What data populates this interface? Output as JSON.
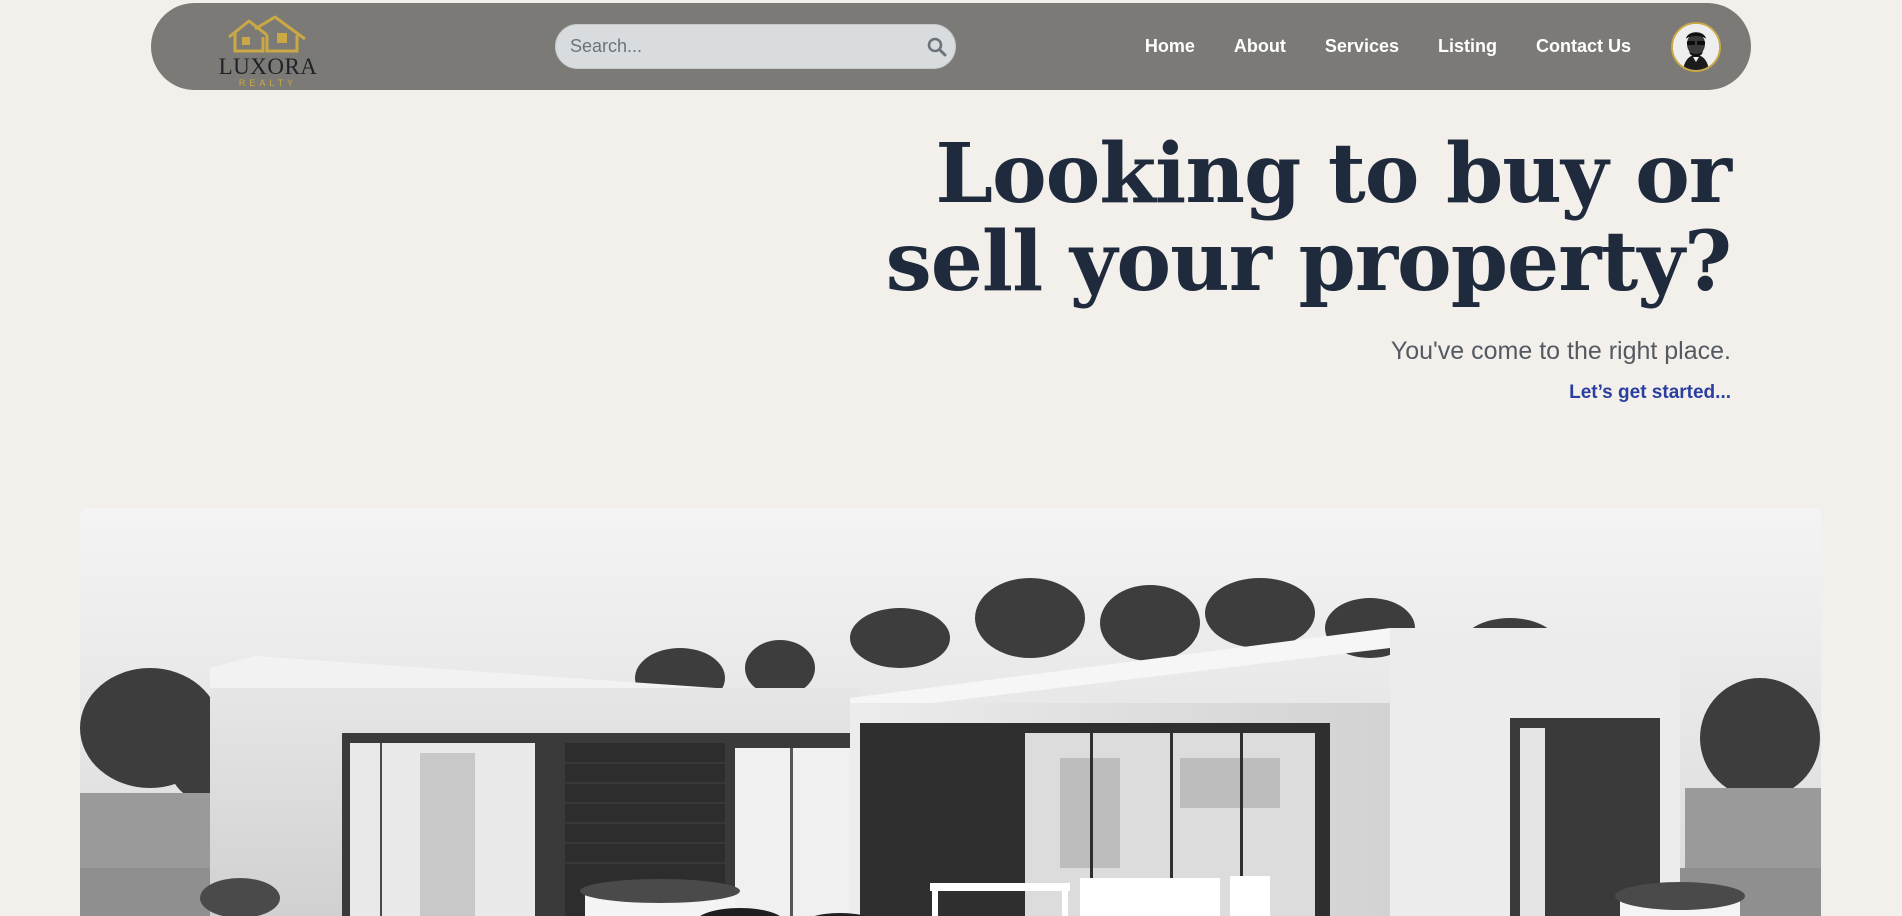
{
  "brand": {
    "name": "LUXORA",
    "tagline": "REALTY",
    "logo_icon": "houses-icon",
    "accent_color": "#c9a845"
  },
  "search": {
    "placeholder": "Search...",
    "icon": "search-icon"
  },
  "nav": {
    "items": [
      {
        "label": "Home"
      },
      {
        "label": "About"
      },
      {
        "label": "Services"
      },
      {
        "label": "Listing"
      },
      {
        "label": "Contact Us"
      }
    ]
  },
  "user": {
    "avatar_icon": "user-avatar"
  },
  "hero": {
    "title_line1": "Looking to buy or",
    "title_line2": "sell your property?",
    "subtitle": "You've come to the right place.",
    "cta": "Let’s get started..."
  },
  "colors": {
    "background": "#f3f0ec",
    "navbar": "#7b7a76",
    "title": "#1f2a3c",
    "cta": "#2a3f9e"
  }
}
